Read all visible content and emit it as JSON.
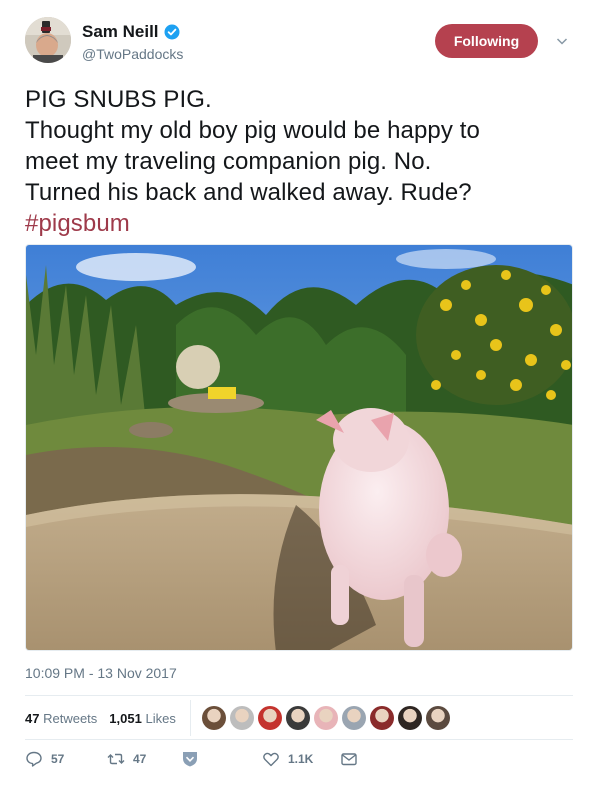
{
  "author": {
    "display_name": "Sam Neill",
    "handle": "@TwoPaddocks",
    "verified_icon": "verified-badge-icon"
  },
  "follow_button": {
    "label": "Following",
    "color": "#b5414f"
  },
  "tweet": {
    "lines": [
      "PIG SNUBS PIG.",
      "Thought my old boy pig would be happy to",
      "meet my traveling companion pig. No.",
      "Turned his back and walked away. Rude?"
    ],
    "hashtag": "#pigsbum",
    "hashtag_color": "#9e3a4a"
  },
  "timestamp": "10:09 PM - 13 Nov 2017",
  "stats": {
    "retweets_count": "47",
    "retweets_label": "Retweets",
    "likes_count": "1,051",
    "likes_label": "Likes"
  },
  "likers": [
    "#6b4f3a",
    "#bdbdbd",
    "#c4332e",
    "#3a3a3a",
    "#e8b4b8",
    "#9aa5b1",
    "#8a2b2b",
    "#2e2622",
    "#5b4a3f"
  ],
  "actions": {
    "reply_count": "57",
    "retweet_count": "47",
    "like_count": "1.1K"
  }
}
